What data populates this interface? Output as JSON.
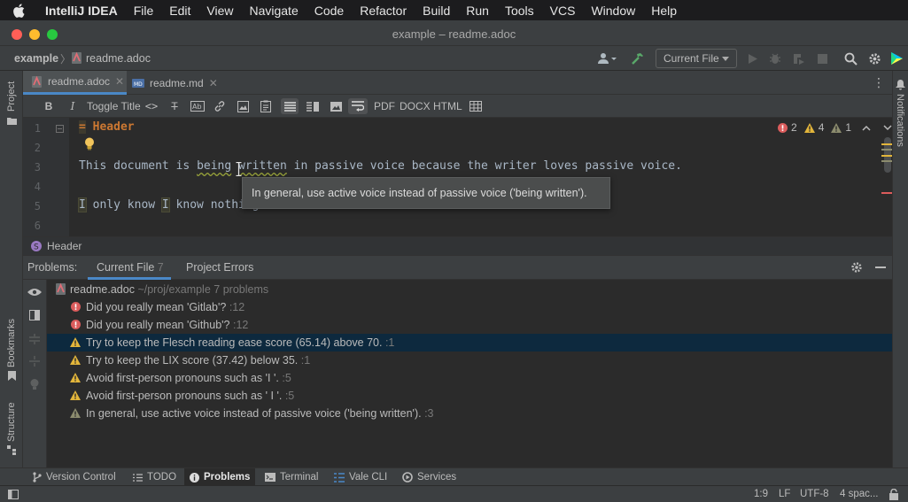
{
  "menubar": {
    "app": "IntelliJ IDEA",
    "items": [
      "File",
      "Edit",
      "View",
      "Navigate",
      "Code",
      "Refactor",
      "Build",
      "Run",
      "Tools",
      "VCS",
      "Window",
      "Help"
    ]
  },
  "window": {
    "title": "example – readme.adoc"
  },
  "navbar": {
    "project": "example",
    "file": "readme.adoc",
    "run_config": "Current File"
  },
  "side_tools": {
    "left_top": "Project",
    "left_mid": "Bookmarks",
    "left_bottom": "Structure",
    "right": "Notifications"
  },
  "tabs": [
    {
      "label": "readme.adoc",
      "active": true
    },
    {
      "label": "readme.md",
      "active": false
    }
  ],
  "adoc_toolbar": {
    "toggle_title": "Toggle Title",
    "pdf": "PDF",
    "docx": "DOCX",
    "html": "HTML"
  },
  "editor": {
    "line_numbers": [
      "1",
      "2",
      "3",
      "4",
      "5",
      "6"
    ],
    "line1_marker": "=",
    "line1_text": "Header",
    "line3_pre": "This document is ",
    "line3_a": "being",
    "line3_b": "written",
    "line3_post": " in passive voice because the writer loves passive voice.",
    "line5_i1": "I",
    "line5_mid": " only know ",
    "line5_i2": "I",
    "line5_post": " know nothing.",
    "errors": "2",
    "warnings": "4",
    "weak_warnings": "1",
    "tooltip": "In general, use active voice instead of passive voice ('being written')."
  },
  "breadcrumb": {
    "label": "Header"
  },
  "problems": {
    "label": "Problems:",
    "tabs": [
      {
        "label": "Current File",
        "count": "7"
      },
      {
        "label": "Project Errors",
        "count": ""
      }
    ],
    "file": {
      "name": "readme.adoc",
      "path": "~/proj/example",
      "count": "7 problems"
    },
    "rows": [
      {
        "severity": "error",
        "text": "Did you really mean 'Gitlab'?",
        "line": ":12"
      },
      {
        "severity": "error",
        "text": "Did you really mean 'Github'?",
        "line": ":12"
      },
      {
        "severity": "warning",
        "text": "Try to keep the Flesch reading ease score (65.14) above 70.",
        "line": ":1"
      },
      {
        "severity": "warning",
        "text": "Try to keep the LIX score (37.42) below 35.",
        "line": ":1"
      },
      {
        "severity": "warning",
        "text": "Avoid first-person pronouns such as 'I '.",
        "line": ":5"
      },
      {
        "severity": "warning",
        "text": "Avoid first-person pronouns such as ' I '.",
        "line": ":5"
      },
      {
        "severity": "weak",
        "text": "In general, use active voice instead of passive voice ('being written').",
        "line": ":3"
      }
    ]
  },
  "tool_windows": [
    "Version Control",
    "TODO",
    "Problems",
    "Terminal",
    "Vale CLI",
    "Services"
  ],
  "status": {
    "position": "1:9",
    "line_sep": "LF",
    "encoding": "UTF-8",
    "indent": "4 spac..."
  },
  "colors": {
    "accent": "#4a88c7",
    "error": "#db5c5c",
    "warning": "#e2b53b",
    "weak_warning": "#8c8c6e",
    "header_text": "#cc7832"
  }
}
